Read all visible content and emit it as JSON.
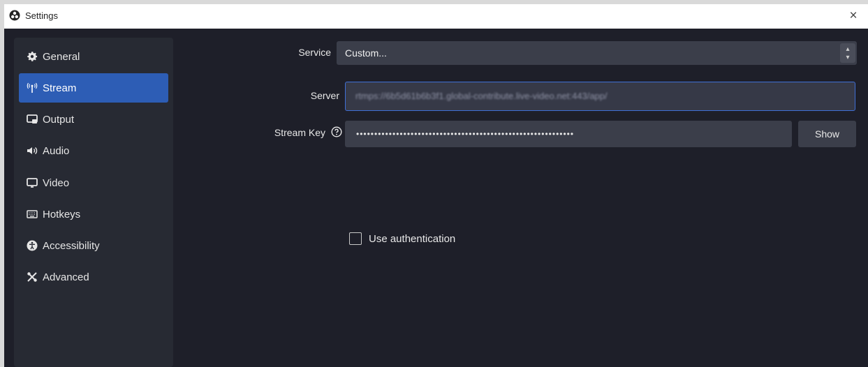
{
  "window": {
    "title": "Settings",
    "close_symbol": "×"
  },
  "sidebar": {
    "items": [
      {
        "label": "General",
        "icon": "gear-icon"
      },
      {
        "label": "Stream",
        "icon": "antenna-icon",
        "active": true
      },
      {
        "label": "Output",
        "icon": "output-icon"
      },
      {
        "label": "Audio",
        "icon": "speaker-icon"
      },
      {
        "label": "Video",
        "icon": "monitor-icon"
      },
      {
        "label": "Hotkeys",
        "icon": "keyboard-icon"
      },
      {
        "label": "Accessibility",
        "icon": "accessibility-icon"
      },
      {
        "label": "Advanced",
        "icon": "tools-icon"
      }
    ]
  },
  "form": {
    "service_label": "Service",
    "service_value": "Custom...",
    "server_label": "Server",
    "server_value": "rtmps://6b5d61b6b3f1.global-contribute.live-video.net:443/app/",
    "stream_key_label": "Stream Key",
    "stream_key_value": "••••••••••••••••••••••••••••••••••••••••••••••••••••••••••••",
    "show_label": "Show",
    "use_auth_label": "Use authentication",
    "use_auth_checked": false
  },
  "colors": {
    "background": "#1e1f29",
    "sidebar": "#272a33",
    "accent": "#2d5db5",
    "input": "#3b3e4a",
    "focus_border": "#3f6fd6"
  }
}
